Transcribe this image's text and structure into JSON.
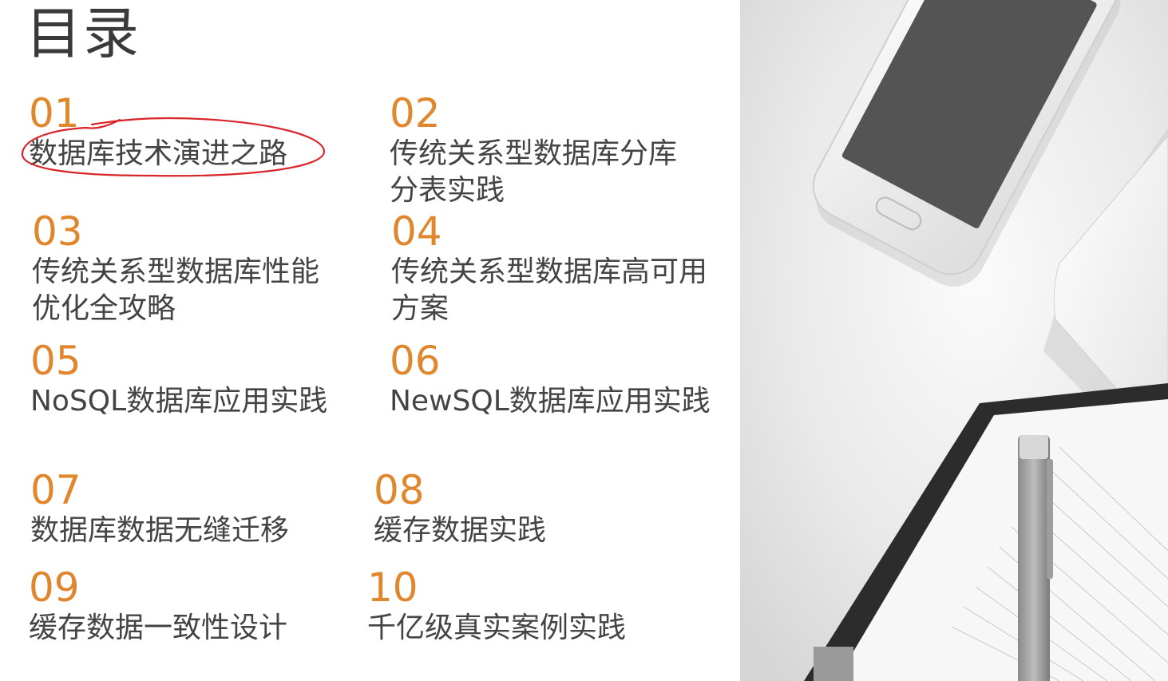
{
  "title": "目录",
  "items": [
    {
      "num": "01",
      "label": "数据库技术演进之路"
    },
    {
      "num": "02",
      "label": "传统关系型数据库分库分表实践"
    },
    {
      "num": "03",
      "label": "传统关系型数据库性能优化全攻略"
    },
    {
      "num": "04",
      "label": "传统关系型数据库高可用方案"
    },
    {
      "num": "05",
      "label": "NoSQL数据库应用实践"
    },
    {
      "num": "06",
      "label": "NewSQL数据库应用实践"
    },
    {
      "num": "07",
      "label": "数据库数据无缝迁移"
    },
    {
      "num": "08",
      "label": "缓存数据实践"
    },
    {
      "num": "09",
      "label": "缓存数据一致性设计"
    },
    {
      "num": "10",
      "label": "千亿级真实案例实践"
    }
  ],
  "colors": {
    "accent": "#e0862d",
    "text": "#444444",
    "annotation": "#d9252a"
  }
}
